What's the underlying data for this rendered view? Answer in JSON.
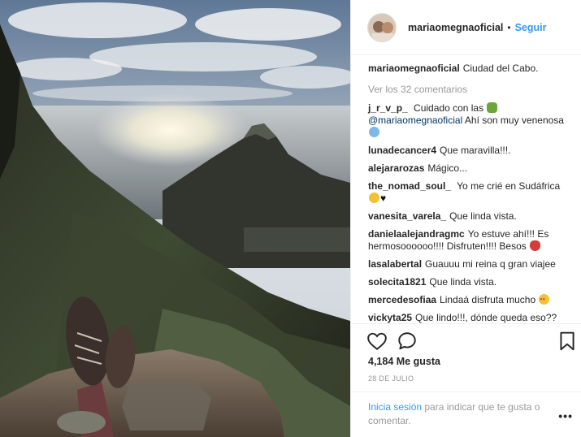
{
  "post": {
    "username": "mariaomegnaoficial",
    "follow_label": "Seguir",
    "separator": "•",
    "caption": "Ciudad del Cabo.",
    "view_all_label": "Ver los 32 comentarios",
    "likes": "4,184 Me gusta",
    "date": "28 DE JULIO"
  },
  "comments": [
    {
      "user": "j_r_v_p_",
      "pre": "Cuidado con las",
      "emoji1": "snake",
      "mention": "@mariaomegnaoficial",
      "post": "Ahí son muy venenosa",
      "emoji2": "scared-face"
    },
    {
      "user": "lunadecancer4",
      "text": "Que maravilla!!!."
    },
    {
      "user": "alejararozas",
      "text": "Mágico..."
    },
    {
      "user": "the_nomad_soul_",
      "text": "Yo me crié en Sudáfrica",
      "emoji1": "grimacing-face",
      "emoji2": "black-heart"
    },
    {
      "user": "vanesita_varela_",
      "text": "Que linda vista."
    },
    {
      "user": "danielaalejandragmc",
      "text": "Yo estuve ahí!!! Es hermosoooooo!!!! Disfruten!!!! Besos",
      "emoji1": "kiss-lips"
    },
    {
      "user": "lasalabertal",
      "text": "Guauuu mi reina q gran viajee"
    },
    {
      "user": "solecita1821",
      "text": "Que linda vista."
    },
    {
      "user": "mercedesofiaa",
      "text": "Lindaá disfruta mucho",
      "emoji1": "heart-eyes-face"
    },
    {
      "user": "vickyta25",
      "text": "Que lindo!!!, dónde queda eso??"
    }
  ],
  "login": {
    "link": "Inicia sesión",
    "text": " para indicar que te gusta o comentar."
  },
  "more_label": "•••",
  "colors": {
    "accent": "#3897f0",
    "text": "#262626",
    "muted": "#999999",
    "border": "#efefef"
  },
  "icons": [
    "heart-icon",
    "comment-icon",
    "bookmark-icon",
    "more-options-icon"
  ]
}
